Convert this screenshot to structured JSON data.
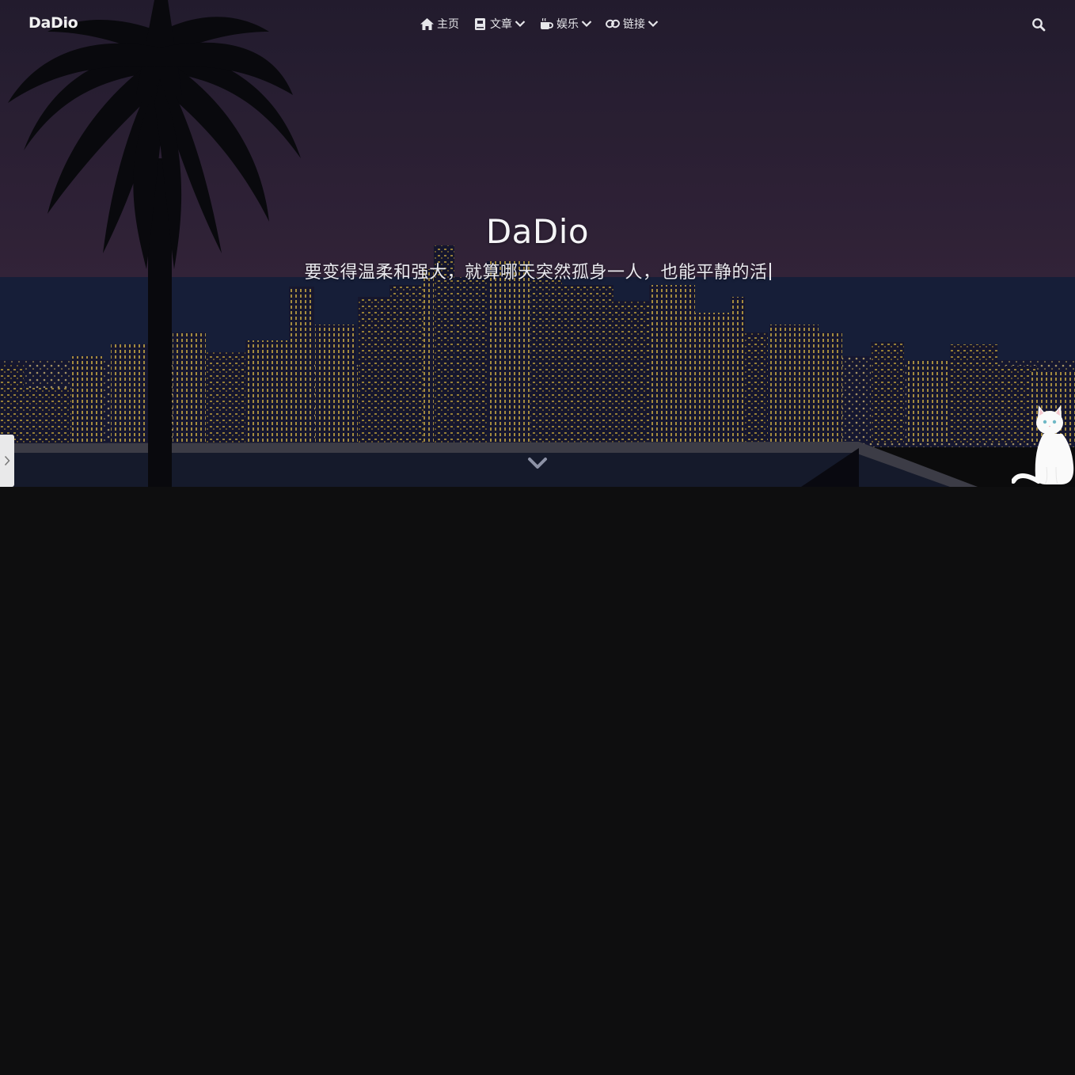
{
  "brand": {
    "name": "DaDio"
  },
  "nav": {
    "items": [
      {
        "label": "主页",
        "icon": "home-icon",
        "has_dropdown": false
      },
      {
        "label": "文章",
        "icon": "book-icon",
        "has_dropdown": true
      },
      {
        "label": "娱乐",
        "icon": "coffee-icon",
        "has_dropdown": true
      },
      {
        "label": "链接",
        "icon": "link-icon",
        "has_dropdown": true
      }
    ],
    "search_icon": "search-icon"
  },
  "hero": {
    "title": "DaDio",
    "subtitle": "要变得温柔和强大，就算哪天突然孤身一人，也能平静的活",
    "scroll_icon": "chevron-down-icon"
  },
  "colors": {
    "page_background": "#0e0e0f",
    "sky_top": "#2a2238",
    "sky_bottom": "#3a2a45",
    "sea": "#1b2544",
    "city_lights": "#c9a94a"
  }
}
